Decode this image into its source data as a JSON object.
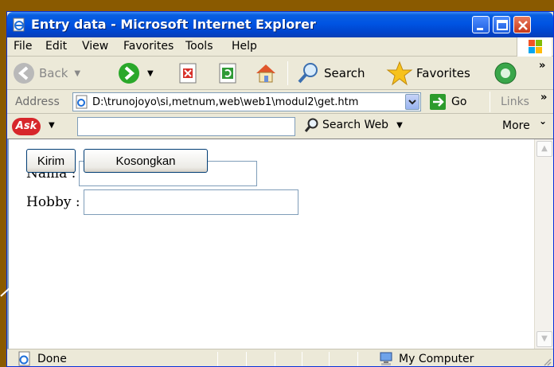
{
  "window": {
    "title": "Entry data - Microsoft Internet Explorer"
  },
  "menu": {
    "items": [
      "File",
      "Edit",
      "View",
      "Favorites",
      "Tools",
      "Help"
    ]
  },
  "toolbar": {
    "back_label": "Back",
    "search_label": "Search",
    "favorites_label": "Favorites"
  },
  "address": {
    "label": "Address",
    "url": "D:\\trunojoyo\\si,metnum,web\\web1\\modul2\\get.htm",
    "go_label": "Go",
    "links_label": "Links"
  },
  "askbar": {
    "logo": "Ask",
    "search_value": "",
    "search_label": "Search Web",
    "more_label": "More"
  },
  "form": {
    "nama_label": "Nama :",
    "nama_value": "",
    "hobby_label": "Hobby :",
    "hobby_value": "",
    "submit_label": "Kirim",
    "reset_label": "Kosongkan"
  },
  "status": {
    "text": "Done",
    "zone": "My Computer"
  },
  "colors": {
    "titlebar": "#0054e3",
    "desktop": "#8a5a00",
    "chrome": "#ece9d8"
  }
}
